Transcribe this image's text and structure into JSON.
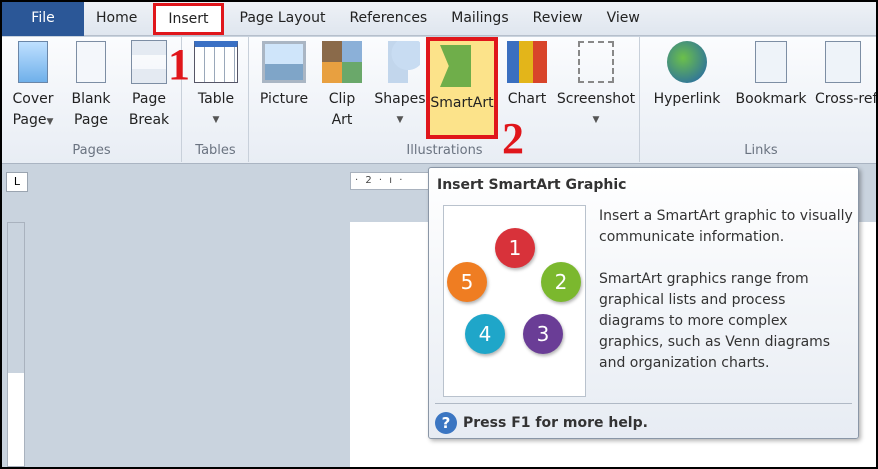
{
  "tabs": [
    "File",
    "Home",
    "Insert",
    "Page Layout",
    "References",
    "Mailings",
    "Review",
    "View"
  ],
  "groups": {
    "pages": "Pages",
    "tables": "Tables",
    "illustrations": "Illustrations",
    "links": "Links"
  },
  "buttons": {
    "cover1": "Cover",
    "cover2": "Page",
    "blank1": "Blank",
    "blank2": "Page",
    "break1": "Page",
    "break2": "Break",
    "table": "Table",
    "picture": "Picture",
    "clip1": "Clip",
    "clip2": "Art",
    "shapes": "Shapes",
    "smartart": "SmartArt",
    "chart": "Chart",
    "screenshot": "Screenshot",
    "hyperlink": "Hyperlink",
    "bookmark": "Bookmark",
    "crossref": "Cross-refere"
  },
  "step_numbers": [
    "1",
    "2"
  ],
  "ruler": {
    "top": "· 2 · ı ·",
    "left_corner": "L"
  },
  "tooltip": {
    "title": "Insert SmartArt Graphic",
    "para1": "Insert a SmartArt graphic to visually communicate information.",
    "para2": "SmartArt graphics range from graphical lists and process diagrams to more complex graphics, such as Venn diagrams and organization charts.",
    "help": "Press F1 for more help.",
    "diagram": [
      "1",
      "2",
      "3",
      "4",
      "5"
    ]
  },
  "colors": {
    "highlight": "#e0161b",
    "file_tab": "#2b5797",
    "smartart_bg": "#fce38a"
  }
}
